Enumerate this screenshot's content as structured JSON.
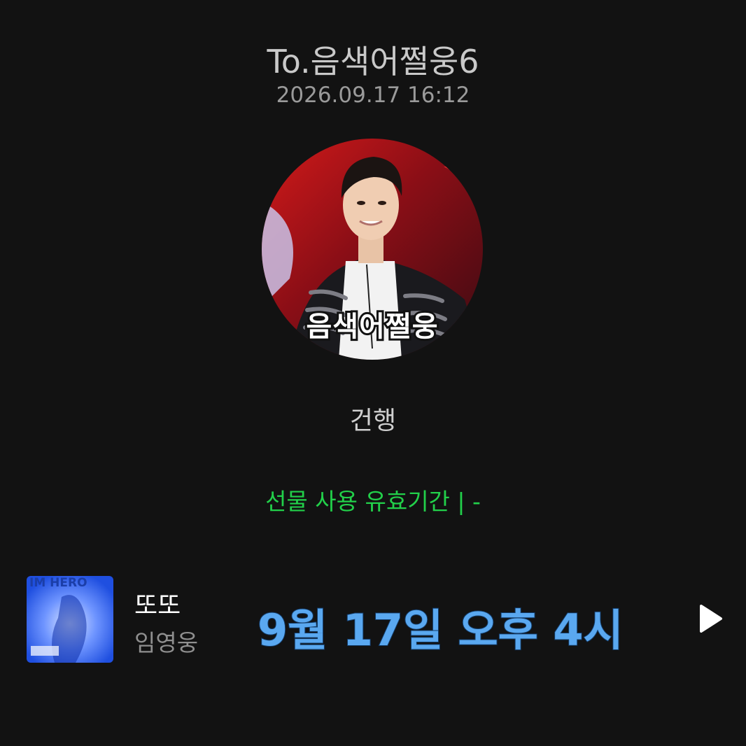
{
  "header": {
    "recipient": "To.음색어쩔웅6",
    "timestamp": "2026.09.17 16:12"
  },
  "profile": {
    "caption": "음색어쩔웅"
  },
  "message": {
    "text": "건행"
  },
  "gift": {
    "validity": "선물 사용 유효기간 |   -"
  },
  "music": {
    "album_text": "IM HERO",
    "title": "또또",
    "artist": "임영웅",
    "play_icon": "play-icon"
  },
  "overlay": {
    "text": "9월 17일 오후 4시"
  },
  "colors": {
    "background": "#121212",
    "validity": "#22d04a",
    "overlay": "#5aa8f0"
  }
}
